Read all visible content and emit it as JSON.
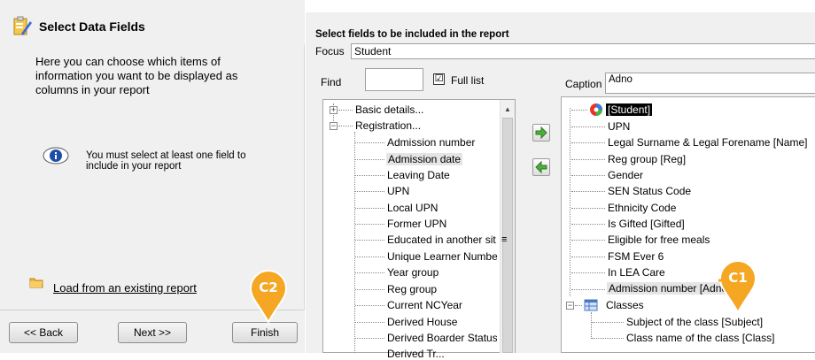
{
  "wizard": {
    "title": "Select Data Fields",
    "description": "Here you can choose which items of information you want to be displayed as columns in your report",
    "info": "You must select at least one field to include in your report",
    "load_link": "Load from an existing report",
    "buttons": {
      "back": "<< Back",
      "next": "Next >>",
      "finish": "Finish"
    }
  },
  "right": {
    "title": "Select fields to be included in the report",
    "focus_label": "Focus",
    "focus_value": "Student",
    "find_label": "Find",
    "find_value": "",
    "full_list_label": "Full list",
    "full_list_checked": "☑",
    "caption_label": "Caption",
    "caption_value": "Adno"
  },
  "field_tree": {
    "groups": [
      "Basic details...",
      "Registration..."
    ],
    "items": [
      "Admission number",
      "Admission date",
      "Leaving Date",
      "UPN",
      "Local UPN",
      "Former UPN",
      "Educated in another sit",
      "Unique Learner Numbe",
      "Year group",
      "Reg group",
      "Current NCYear",
      "Derived House",
      "Derived Boarder Status",
      "Derived Tr..."
    ],
    "scroll_marker": "≡"
  },
  "selected_tree": {
    "root": "[Student]",
    "items": [
      "UPN",
      "Legal Surname & Legal Forename [Name]",
      "Reg group [Reg]",
      "Gender",
      "SEN Status Code",
      "Ethnicity Code",
      "Is Gifted [Gifted]",
      "Eligible for free meals",
      "FSM Ever 6",
      "In LEA Care",
      "Admission number [Adno]"
    ],
    "classes_group": "Classes",
    "classes_items": [
      "Subject of the class [Subject]",
      "Class name of the class [Class]"
    ]
  },
  "callouts": {
    "c1": "C1",
    "c2": "C2"
  },
  "colors": {
    "callout": "#f5a623",
    "callout_dark": "#e0951a"
  },
  "icons": [
    "wizard-icon",
    "info-icon",
    "folder-icon",
    "add-arrow-icon",
    "remove-arrow-icon",
    "student-root-icon",
    "classes-icon"
  ]
}
